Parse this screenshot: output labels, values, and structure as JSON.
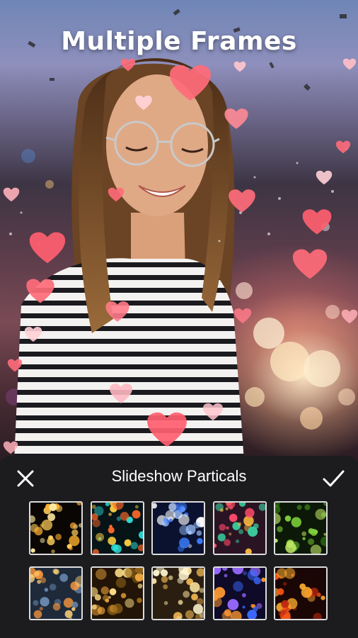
{
  "header": {
    "title": "Multiple Frames"
  },
  "panel": {
    "title": "Slideshow Particals",
    "close_icon": "close-icon",
    "confirm_icon": "checkmark-icon"
  },
  "thumbnails": [
    {
      "name": "thumb-gold-bokeh",
      "bg": "#0a0604",
      "colors": [
        "#ffcf5a",
        "#ffb030",
        "#ffe9a0"
      ]
    },
    {
      "name": "thumb-teal-orange-bokeh",
      "bg": "#061418",
      "colors": [
        "#2fe0d8",
        "#ff6a2a",
        "#ffd040"
      ]
    },
    {
      "name": "thumb-blue-lights",
      "bg": "#0a1230",
      "colors": [
        "#3c7dff",
        "#9fc4ff",
        "#ffffff"
      ]
    },
    {
      "name": "thumb-colorful-bokeh",
      "bg": "#2a1424",
      "colors": [
        "#ff4a6a",
        "#3cd0a0",
        "#ffc040"
      ]
    },
    {
      "name": "thumb-green-glitter",
      "bg": "#0c1808",
      "colors": [
        "#7ed23a",
        "#c8f06a",
        "#3a8a18"
      ]
    },
    {
      "name": "thumb-city-bokeh",
      "bg": "#1e2a3a",
      "colors": [
        "#ff9a3c",
        "#ffd27a",
        "#6a8ab0"
      ]
    },
    {
      "name": "thumb-warm-gold-bokeh",
      "bg": "#221406",
      "colors": [
        "#ffb240",
        "#ffe08a",
        "#9a6a1a"
      ]
    },
    {
      "name": "thumb-golden-sparkle",
      "bg": "#2a1e10",
      "colors": [
        "#ffe6a0",
        "#e8b050",
        "#fff6d0"
      ]
    },
    {
      "name": "thumb-blue-purple-bokeh",
      "bg": "#0e0a28",
      "colors": [
        "#3a6aff",
        "#ff9a30",
        "#9a6aff"
      ]
    },
    {
      "name": "thumb-red-orange-bokeh",
      "bg": "#1a0604",
      "colors": [
        "#ff5a1a",
        "#ffb030",
        "#c02a10"
      ]
    }
  ]
}
